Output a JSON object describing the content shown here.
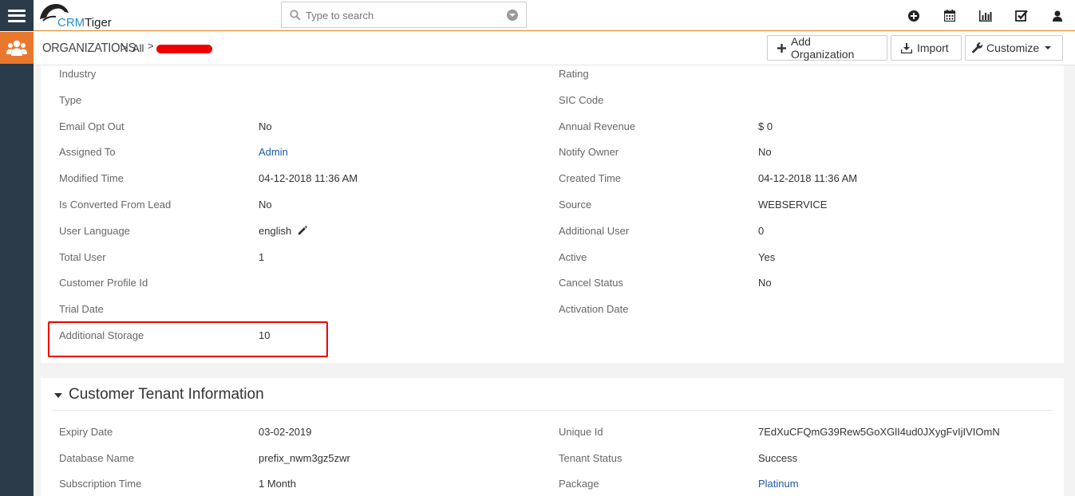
{
  "app": {
    "logo_part1": "CRM",
    "logo_part2": "Tiger",
    "search_placeholder": "Type to search",
    "top_icons": [
      "plus-circle-icon",
      "calendar-icon",
      "bar-chart-icon",
      "check-square-icon",
      "user-icon"
    ]
  },
  "breadcrumb": {
    "module": "ORGANIZATIONS",
    "separator": ">",
    "filter": "All"
  },
  "actions": {
    "add_label": "Add Organization",
    "import_label": "Import",
    "customize_label": "Customize"
  },
  "details": {
    "left": [
      {
        "label": "Industry",
        "value": ""
      },
      {
        "label": "Type",
        "value": ""
      },
      {
        "label": "Email Opt Out",
        "value": "No"
      },
      {
        "label": "Assigned To",
        "value": "Admin"
      },
      {
        "label": "Modified Time",
        "value": "04-12-2018 11:36 AM"
      },
      {
        "label": "Is Converted From Lead",
        "value": "No"
      },
      {
        "label": "User Language",
        "value": "english"
      },
      {
        "label": "Total User",
        "value": "1"
      },
      {
        "label": "Customer Profile Id",
        "value": ""
      },
      {
        "label": "Trial Date",
        "value": ""
      },
      {
        "label": "Additional Storage",
        "value": "10"
      }
    ],
    "right": [
      {
        "label": "Rating",
        "value": ""
      },
      {
        "label": "SIC Code",
        "value": ""
      },
      {
        "label": "Annual Revenue",
        "value": "$ 0"
      },
      {
        "label": "Notify Owner",
        "value": "No"
      },
      {
        "label": "Created Time",
        "value": "04-12-2018 11:36 AM"
      },
      {
        "label": "Source",
        "value": "WEBSERVICE"
      },
      {
        "label": "Additional User",
        "value": "0"
      },
      {
        "label": "Active",
        "value": "Yes"
      },
      {
        "label": "Cancel Status",
        "value": "No"
      },
      {
        "label": "Activation Date",
        "value": ""
      }
    ]
  },
  "tenant": {
    "title": "Customer Tenant Information",
    "left": [
      {
        "label": "Expiry Date",
        "value": "03-02-2019"
      },
      {
        "label": "Database Name",
        "value": "prefix_nwm3gz5zwr"
      },
      {
        "label": "Subscription Time",
        "value": "1 Month"
      }
    ],
    "right": [
      {
        "label": "Unique Id",
        "value": "7EdXuCFQmG39Rew5GoXGlI4ud0JXygFvIjIVIOmN"
      },
      {
        "label": "Tenant Status",
        "value": "Success"
      },
      {
        "label": "Package",
        "value": "Platinum"
      }
    ]
  },
  "colors": {
    "sidebar": "#2c3b49",
    "accent": "#e8782d",
    "link": "#1e5aa8",
    "highlight": "#ee0000"
  }
}
